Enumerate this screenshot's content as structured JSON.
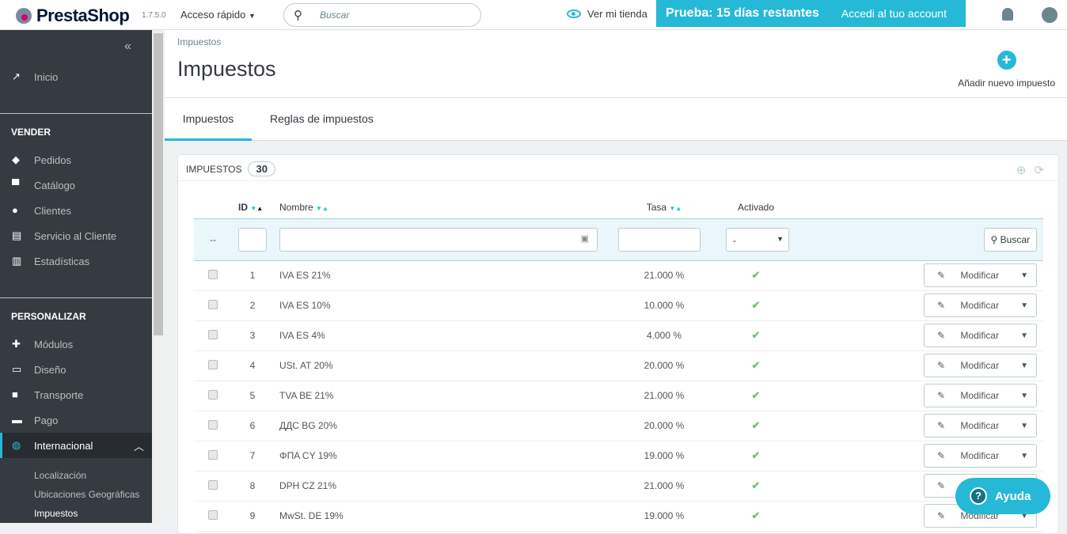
{
  "topbar": {
    "brand": "PrestaShop",
    "version": "1.7.5.0",
    "quick_access": "Acceso rápido",
    "search_placeholder": "Buscar",
    "view_store": "Ver mi tienda",
    "trial": "Prueba: 15 días restantes",
    "account": "Accedi al tuo account"
  },
  "sidebar": {
    "home": "Inicio",
    "sell": "VENDER",
    "sell_items": [
      "Pedidos",
      "Catálogo",
      "Clientes",
      "Servicio al Cliente",
      "Estadísticas"
    ],
    "customize": "PERSONALIZAR",
    "customize_items": [
      "Módulos",
      "Diseño",
      "Transporte",
      "Pago",
      "Internacional"
    ],
    "sub_items": [
      "Localización",
      "Ubicaciones Geográficas",
      "Impuestos"
    ]
  },
  "header": {
    "breadcrumb": "Impuestos",
    "title": "Impuestos",
    "add_label": "Añadir nuevo impuesto"
  },
  "tabs": [
    "Impuestos",
    "Reglas de impuestos"
  ],
  "panel": {
    "title": "IMPUESTOS",
    "count": "30",
    "columns": {
      "id": "ID",
      "name": "Nombre",
      "rate": "Tasa",
      "enabled": "Activado"
    },
    "filter_dash": "--",
    "filter_select": "-",
    "search_button": "Buscar",
    "edit_label": "Modificar",
    "rows": [
      {
        "id": "1",
        "name": "IVA ES 21%",
        "rate": "21.000 %"
      },
      {
        "id": "2",
        "name": "IVA ES 10%",
        "rate": "10.000 %"
      },
      {
        "id": "3",
        "name": "IVA ES 4%",
        "rate": "4.000 %"
      },
      {
        "id": "4",
        "name": "USt. AT 20%",
        "rate": "20.000 %"
      },
      {
        "id": "5",
        "name": "TVA BE 21%",
        "rate": "21.000 %"
      },
      {
        "id": "6",
        "name": "ДДС BG 20%",
        "rate": "20.000 %"
      },
      {
        "id": "7",
        "name": "ΦΠΑ CY 19%",
        "rate": "19.000 %"
      },
      {
        "id": "8",
        "name": "DPH CZ 21%",
        "rate": "21.000 %"
      },
      {
        "id": "9",
        "name": "MwSt. DE 19%",
        "rate": "19.000 %"
      }
    ]
  },
  "help": "Ayuda"
}
